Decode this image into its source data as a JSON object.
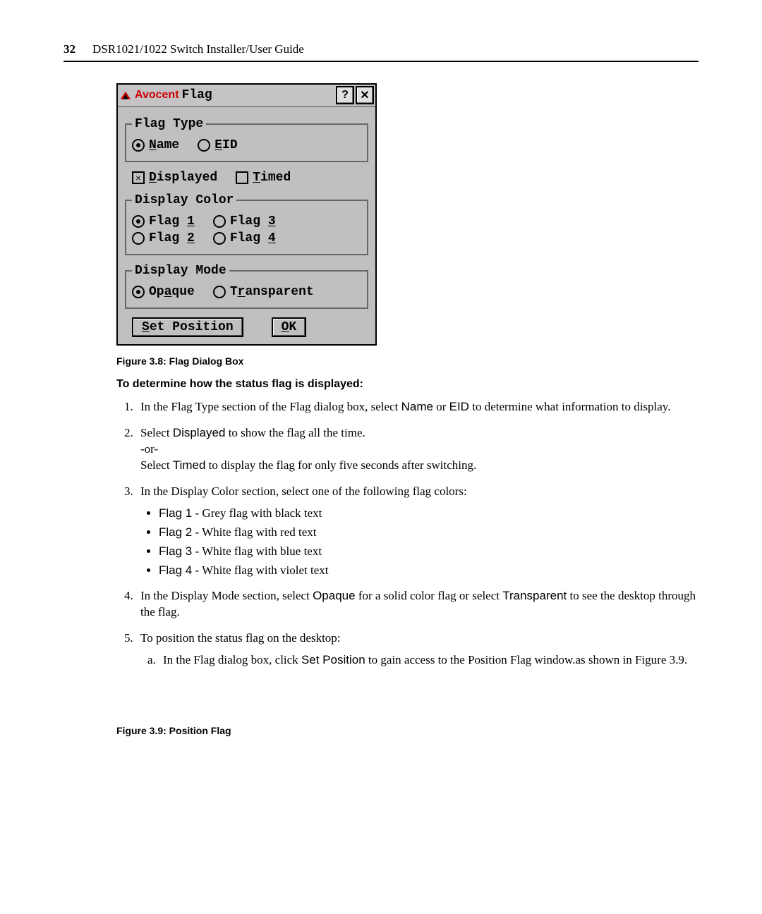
{
  "header": {
    "page_number": "32",
    "guide_title": "DSR1021/1022 Switch Installer/User Guide"
  },
  "dialog": {
    "brand": "Avocent",
    "window_title": "Flag",
    "help_btn": "?",
    "close_btn": "✕",
    "flag_type_legend": "Flag Type",
    "name_label_pre": "N",
    "name_label_rest": "ame",
    "eid_label_pre": "E",
    "eid_label_rest": "ID",
    "displayed_pre": "D",
    "displayed_rest": "isplayed",
    "timed_pre": "T",
    "timed_rest": "imed",
    "display_color_legend": "Display Color",
    "flag1_pre": "Flag ",
    "flag1_u": "1",
    "flag2_pre": "Flag ",
    "flag2_u": "2",
    "flag3_pre": "Flag ",
    "flag3_u": "3",
    "flag4_pre": "Flag ",
    "flag4_u": "4",
    "display_mode_legend": "Display Mode",
    "opaque_pre": "Op",
    "opaque_u": "a",
    "opaque_post": "que",
    "transparent_pre": "T",
    "transparent_u": "r",
    "transparent_post": "ansparent",
    "set_position_u": "S",
    "set_position_rest": "et Position",
    "ok_u": "O",
    "ok_rest": "K"
  },
  "captions": {
    "fig38": "Figure 3.8: Flag Dialog Box",
    "section": "To determine how the status flag is displayed:",
    "fig39": "Figure 3.9: Position Flag"
  },
  "steps": {
    "s1a": "In the Flag Type section of the Flag dialog box, select ",
    "s1_name": "Name",
    "s1b": " or ",
    "s1_eid": "EID",
    "s1c": " to determine what information to display.",
    "s2a": "Select ",
    "s2_displayed": "Displayed",
    "s2b": " to show the flag all the time.",
    "s2_or": "-or-",
    "s2c": "Select ",
    "s2_timed": "Timed",
    "s2d": " to display the flag for only five seconds after switching.",
    "s3": "In the Display Color section, select one of the following flag colors:",
    "s3_f1_b": "Flag 1",
    "s3_f1_t": " - Grey flag with black text",
    "s3_f2_b": "Flag 2",
    "s3_f2_t": " - White flag with red text",
    "s3_f3_b": "Flag 3",
    "s3_f3_t": " - White flag with blue text",
    "s3_f4_b": "Flag 4",
    "s3_f4_t": " - White flag with violet text",
    "s4a": "In the Display Mode section, select ",
    "s4_opaque": "Opaque",
    "s4b": " for a solid color flag or select ",
    "s4_transparent": "Transparent",
    "s4c": " to see the desktop through the flag.",
    "s5": "To position the status flag on the desktop:",
    "s5a_a": "In the Flag dialog box, click ",
    "s5a_sp": "Set Position",
    "s5a_b": " to gain access to the Position Flag window.as shown in Figure 3.9."
  }
}
